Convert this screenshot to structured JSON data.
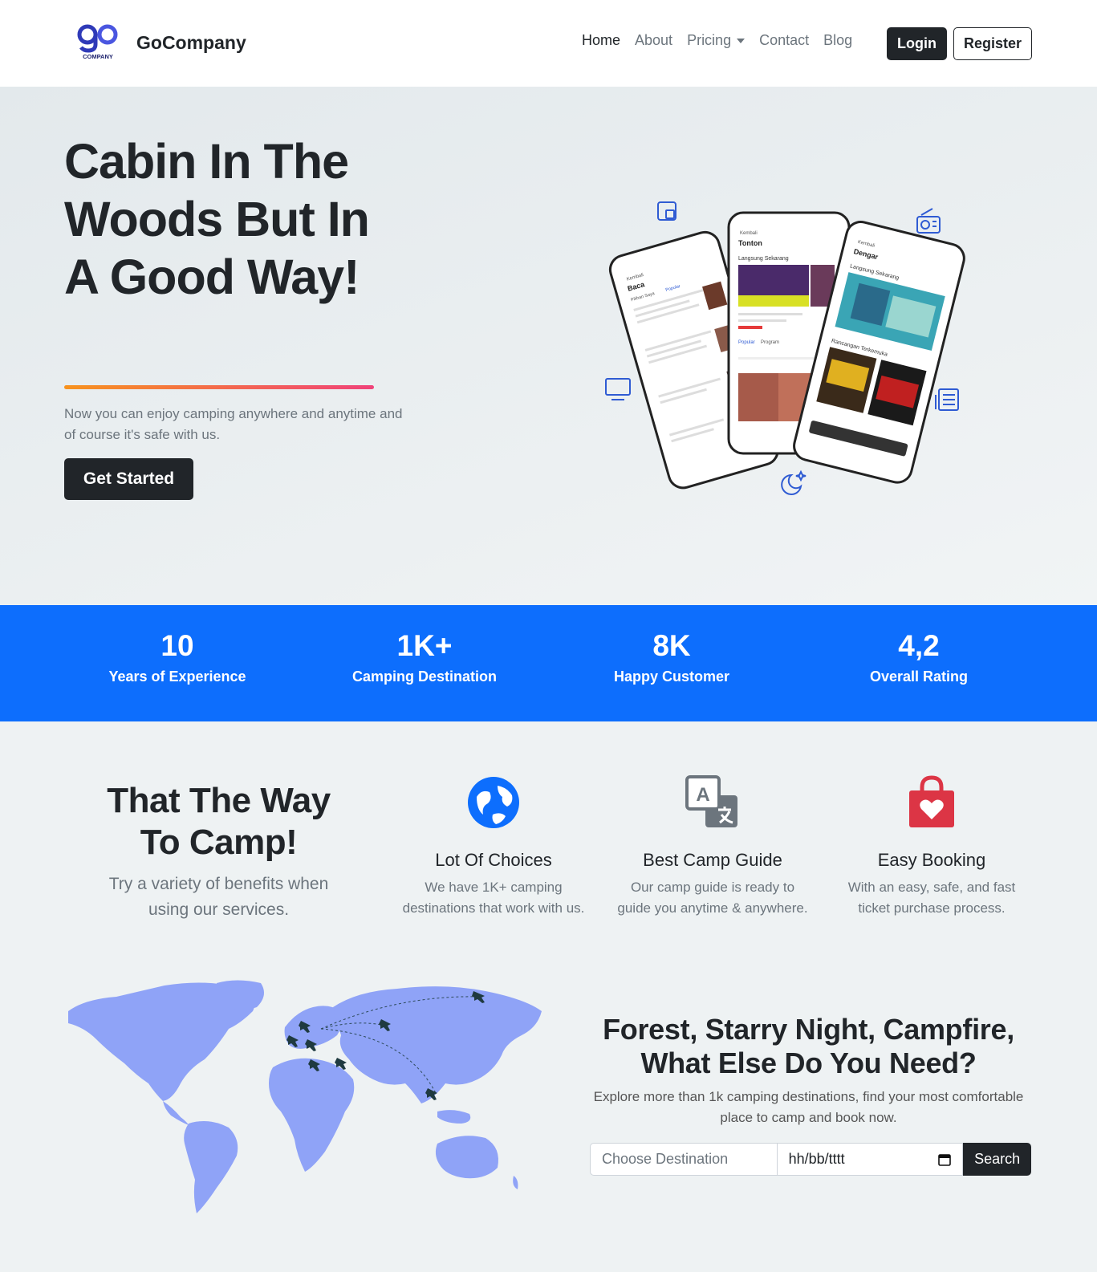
{
  "brand": {
    "name": "GoCompany",
    "logo_word": "go",
    "logo_sub": "COMPANY"
  },
  "nav": {
    "items": [
      {
        "label": "Home",
        "active": true
      },
      {
        "label": "About",
        "active": false
      },
      {
        "label": "Pricing",
        "active": false,
        "dropdown": true
      },
      {
        "label": "Contact",
        "active": false
      },
      {
        "label": "Blog",
        "active": false
      }
    ],
    "login_label": "Login",
    "register_label": "Register"
  },
  "hero": {
    "title_line1": "Cabin In The",
    "title_line2": "Woods But In",
    "title_line3": "A Good Way!",
    "subtitle": "Now you can enjoy camping anywhere and anytime and of course it's safe with us.",
    "cta_label": "Get Started",
    "phone_screens": [
      "Baca",
      "Tonton",
      "Dengar"
    ],
    "phone_texts": {
      "back": "Kembali",
      "live": "Langsung Sekarang",
      "popular": "Popular",
      "program": "Program",
      "top": "Rancangan Terkemuka",
      "pilihan": "Pilihan Saya"
    }
  },
  "stats": [
    {
      "value": "10",
      "label": "Years of Experience"
    },
    {
      "value": "1K+",
      "label": "Camping Destination"
    },
    {
      "value": "8K",
      "label": "Happy Customer"
    },
    {
      "value": "4,2",
      "label": "Overall Rating"
    }
  ],
  "features_intro": {
    "title_line1": "That The Way",
    "title_line2": "To Camp!",
    "subtitle": "Try a variety of benefits when using our services."
  },
  "features": [
    {
      "icon": "globe-icon",
      "title": "Lot Of Choices",
      "text": "We have 1K+ camping destinations that work with us."
    },
    {
      "icon": "translate-icon",
      "title": "Best Camp Guide",
      "text": "Our camp guide is ready to guide you anytime & anywhere."
    },
    {
      "icon": "shopping-bag-heart-icon",
      "title": "Easy Booking",
      "text": "With an easy, safe, and fast ticket purchase process."
    }
  ],
  "search": {
    "title_line1": "Forest, Starry Night, Campfire,",
    "title_line2": "What Else Do You Need?",
    "subtitle": "Explore more than 1k camping destinations, find your most comfortable place to camp and book now.",
    "destination_placeholder": "Choose Destination",
    "date_placeholder": "hh/bb/tttt",
    "button_label": "Search"
  },
  "colors": {
    "primary": "#0d6efd",
    "dark": "#212529",
    "muted": "#6c757d",
    "map": "#8fa3f7",
    "favorite": "#dc3545",
    "gradient_start": "#f7931e",
    "gradient_end": "#f0427a"
  }
}
